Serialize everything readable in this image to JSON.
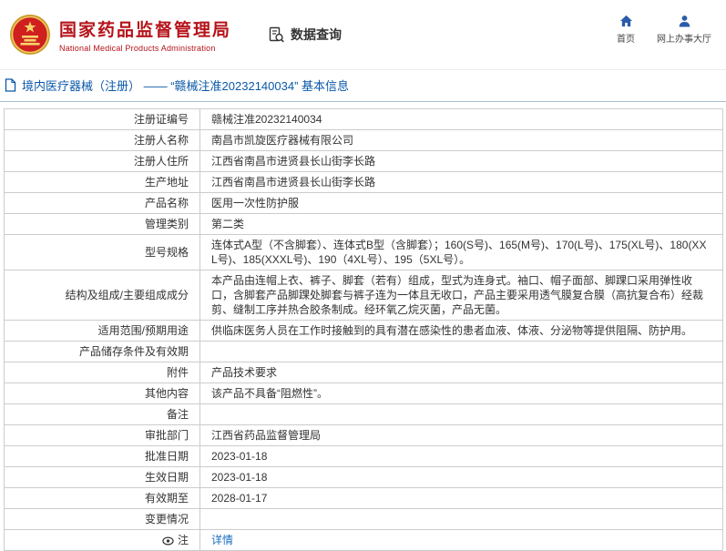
{
  "header": {
    "org_name_cn": "国家药品监督管理局",
    "org_name_en": "National Medical Products Administration",
    "section_title": "数据查询",
    "nav": [
      {
        "label": "首页",
        "icon": "home-icon"
      },
      {
        "label": "网上办事大厅",
        "icon": "user-icon"
      }
    ]
  },
  "page": {
    "title": "境内医疗器械（注册） ——  “赣械注准20232140034”  基本信息"
  },
  "colors": {
    "brand_red": "#b5131a",
    "title_blue": "#0a58a8",
    "link_blue": "#1b6fc0",
    "nav_icon_blue": "#2a5caa",
    "table_border": "#cccccc"
  },
  "table": {
    "rows": [
      {
        "label": "注册证编号",
        "value": "赣械注准20232140034"
      },
      {
        "label": "注册人名称",
        "value": "南昌市凯旋医疗器械有限公司"
      },
      {
        "label": "注册人住所",
        "value": "江西省南昌市进贤县长山街李长路"
      },
      {
        "label": "生产地址",
        "value": "江西省南昌市进贤县长山街李长路"
      },
      {
        "label": "产品名称",
        "value": "医用一次性防护服"
      },
      {
        "label": "管理类别",
        "value": "第二类"
      },
      {
        "label": "型号规格",
        "value": "连体式A型（不含脚套）、连体式B型（含脚套）；160(S号)、165(M号)、170(L号)、175(XL号)、180(XXL号)、185(XXXL号)、190（4XL号）、195（5XL号）。"
      },
      {
        "label": "结构及组成/主要组成成分",
        "value": "本产品由连帽上衣、裤子、脚套（若有）组成，型式为连身式。袖口、帽子面部、脚踝口采用弹性收口，含脚套产品脚踝处脚套与裤子连为一体且无收口，产品主要采用透气膜复合膜（高抗复合布）经裁剪、缝制工序并热合胶条制成。经环氧乙烷灭菌，产品无菌。"
      },
      {
        "label": "适用范围/预期用途",
        "value": "供临床医务人员在工作时接触到的具有潜在感染性的患者血液、体液、分泌物等提供阻隔、防护用。"
      },
      {
        "label": "产品储存条件及有效期",
        "value": ""
      },
      {
        "label": "附件",
        "value": "产品技术要求"
      },
      {
        "label": "其他内容",
        "value": "该产品不具备“阻燃性”。"
      },
      {
        "label": "备注",
        "value": ""
      },
      {
        "label": "审批部门",
        "value": "江西省药品监督管理局"
      },
      {
        "label": "批准日期",
        "value": "2023-01-18"
      },
      {
        "label": "生效日期",
        "value": "2023-01-18"
      },
      {
        "label": "有效期至",
        "value": "2028-01-17"
      },
      {
        "label": "变更情况",
        "value": ""
      },
      {
        "label": "注",
        "value": "详情",
        "link": true
      }
    ]
  }
}
